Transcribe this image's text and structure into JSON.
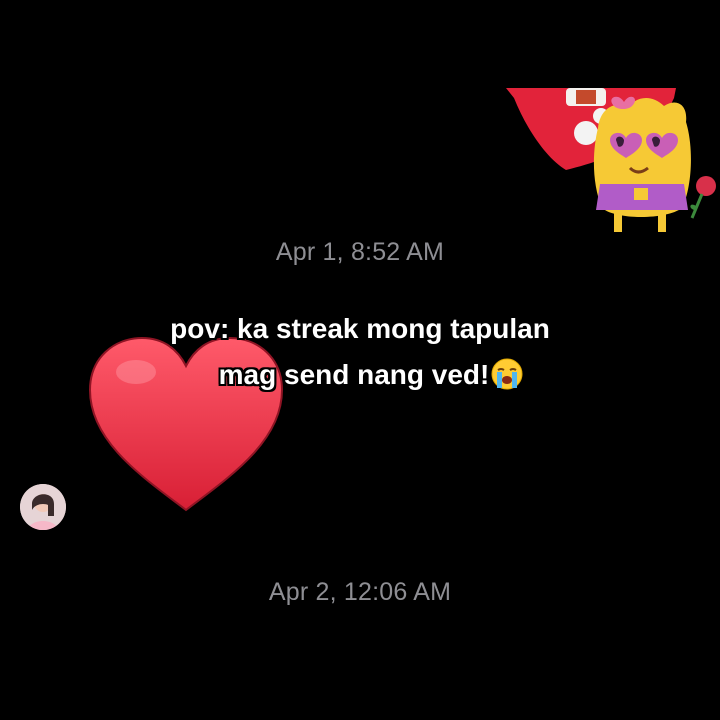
{
  "thread": {
    "messages": [
      {
        "timestamp": "Apr 1, 8:52 AM"
      },
      {
        "timestamp": "Apr 2, 12:06 AM"
      }
    ]
  },
  "overlay": {
    "caption_line1": "pov: ka streak mong tapulan",
    "caption_line2": "mag send nang ved!",
    "caption_emoji": "loudly-crying-face-icon"
  },
  "reactions": {
    "heart_icon": "red-heart-icon",
    "sticker_icon": "yellow-cartoon-character-sticker-icon"
  },
  "sender": {
    "avatar_icon": "profile-avatar"
  },
  "colors": {
    "background": "#000000",
    "timestamp": "#8e8e93",
    "caption": "#ffffff",
    "heart": "#f0364a"
  }
}
